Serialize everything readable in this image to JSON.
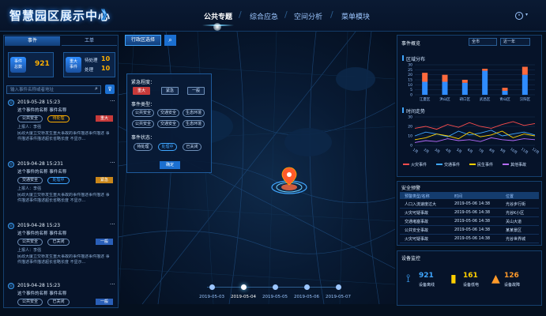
{
  "header": {
    "title": "智慧园区展示中心",
    "chevron": "》",
    "nav": [
      {
        "label": "公共专题",
        "active": true
      },
      {
        "label": "综合应急",
        "active": false
      },
      {
        "label": "空间分析",
        "active": false
      },
      {
        "label": "菜单模块",
        "active": false
      }
    ],
    "user_icon": "user-icon",
    "caret": "▾"
  },
  "left": {
    "tabs": [
      "事件",
      "工单"
    ],
    "summary": {
      "total_label_1": "事件",
      "total_label_2": "总数",
      "total_value": "921",
      "handled_label_1": "重大",
      "handled_label_2": "事件",
      "pending_label": "待处理",
      "pending_value": "10",
      "done_label": "处理",
      "done_value": "10"
    },
    "search_placeholder": "输入事件名称或者地址",
    "cards": [
      {
        "time": "2019-05-28  15:23",
        "title": "这个事件的名称  事件名称",
        "tags": [
          "公共安全",
          "待处理"
        ],
        "level": "重大",
        "reporter": "上报人：李强",
        "body": "民政大厦立交桥发生重大事故的事件描述事件描述  事件描述事件描述超长省略长度  不显示..."
      },
      {
        "time": "2019-04-28  15:231",
        "title": "这个事件的名称  事件名称",
        "tags": [
          "交通安全",
          "处理中"
        ],
        "level": "紧急",
        "reporter": "上报人：李强",
        "body": "民政大厦立交桥发生重大事故的事件描述事件描述  事件描述事件描述超长省略长度  不显示..."
      },
      {
        "time": "2019-04-28  15:23",
        "title": "这个事件的名称  事件名称",
        "tags": [
          "公共安全",
          "已关闭"
        ],
        "level": "一般",
        "reporter": "上报人：李强",
        "body": "民政大厦立交桥发生重大事故的事件描述事件描述  事件描述事件描述超长省略长度  不显示..."
      },
      {
        "time": "2019-04-28  15:23",
        "title": "这个事件的名称  事件名称",
        "tags": [
          "公共安全",
          "已关闭"
        ],
        "level": "一般",
        "reporter": "",
        "body": ""
      }
    ],
    "more": "···"
  },
  "district": {
    "label": "行政区选择",
    "popup": {
      "level_title": "紧急程度：",
      "level_opts": [
        "重大",
        "紧急",
        "一般"
      ],
      "type_title": "事件类型：",
      "type_opts": [
        "公共安全",
        "交通安全",
        "生态环境",
        "公共安全",
        "交通安全",
        "生态环境"
      ],
      "status_title": "事件状态：",
      "status_opts": [
        "待处理",
        "处理中",
        "已关闭"
      ],
      "confirm": "确定"
    }
  },
  "timeline": {
    "dates": [
      "2019-05-03",
      "2019-05-04",
      "2019-05-05",
      "2019-05-06",
      "2019-05-07"
    ],
    "active_index": 1
  },
  "right": {
    "overview_title": "事件概览",
    "select_city": "全市",
    "select_range": "近一年",
    "district_title": "区域分布",
    "trend_title": "时间走势",
    "legend": [
      "火灾事件",
      "交通事件",
      "民生事件",
      "其他事故"
    ],
    "warning_title": "安全预警",
    "warning_headers": [
      "预警类型/名称",
      "时间",
      "位置"
    ],
    "warning_rows": [
      [
        "人口入流速度过大",
        "2019-05-06  14:38",
        "光谷步行街"
      ],
      [
        "火灾可疑事故",
        "2019-05-06  14:38",
        "光谷K小区"
      ],
      [
        "交通堵塞事故",
        "2019-05-06  14:38",
        "关山大道"
      ],
      [
        "公共安全事故",
        "2019-05-06  14:38",
        "某某景区"
      ],
      [
        "火灾可疑事故",
        "2019-05-06  14:38",
        "光谷世界城"
      ]
    ],
    "device_title": "设备监控",
    "devices": [
      {
        "value": "921",
        "label": "设备离线",
        "color": "#3fa6ff",
        "icon": "signal-icon"
      },
      {
        "value": "161",
        "label": "设备低电",
        "color": "#ffd000",
        "icon": "battery-icon"
      },
      {
        "value": "126",
        "label": "设备故障",
        "color": "#ff9a2a",
        "icon": "warning-icon"
      }
    ]
  },
  "chart_data": [
    {
      "type": "bar",
      "title": "区域分布",
      "categories": [
        "江夏区",
        "洪山区",
        "硚口区",
        "武昌区",
        "青山区",
        "汉阳区"
      ],
      "ylim": [
        0,
        30
      ],
      "yticks": [
        0,
        5,
        10,
        15,
        20,
        25,
        30
      ],
      "series": [
        {
          "values": [
            13,
            13,
            12,
            24,
            4,
            20
          ],
          "color": "#2f8cff"
        },
        {
          "values": [
            9,
            7,
            3,
            2,
            3,
            8
          ],
          "color": "#ff6a3d"
        }
      ]
    },
    {
      "type": "line",
      "title": "时间走势",
      "categories": [
        "1月",
        "2月",
        "3月",
        "4月",
        "5月",
        "6月",
        "7月",
        "8月",
        "9月",
        "10月",
        "11月",
        "12月"
      ],
      "ylim": [
        0,
        30
      ],
      "yticks": [
        0,
        10,
        20,
        30
      ],
      "series": [
        {
          "name": "火灾事件",
          "values": [
            18,
            20,
            17,
            22,
            19,
            24,
            20,
            18,
            22,
            25,
            21,
            23
          ],
          "color": "#ff4d4d"
        },
        {
          "name": "交通事件",
          "values": [
            10,
            14,
            12,
            9,
            15,
            11,
            13,
            16,
            10,
            12,
            14,
            11
          ],
          "color": "#3fa6ff"
        },
        {
          "name": "民生事件",
          "values": [
            6,
            8,
            12,
            10,
            7,
            14,
            9,
            11,
            15,
            8,
            12,
            10
          ],
          "color": "#ffd000"
        },
        {
          "name": "其他事故",
          "values": [
            3,
            5,
            4,
            7,
            5,
            6,
            4,
            8,
            6,
            5,
            7,
            6
          ],
          "color": "#b56cff"
        }
      ]
    }
  ]
}
